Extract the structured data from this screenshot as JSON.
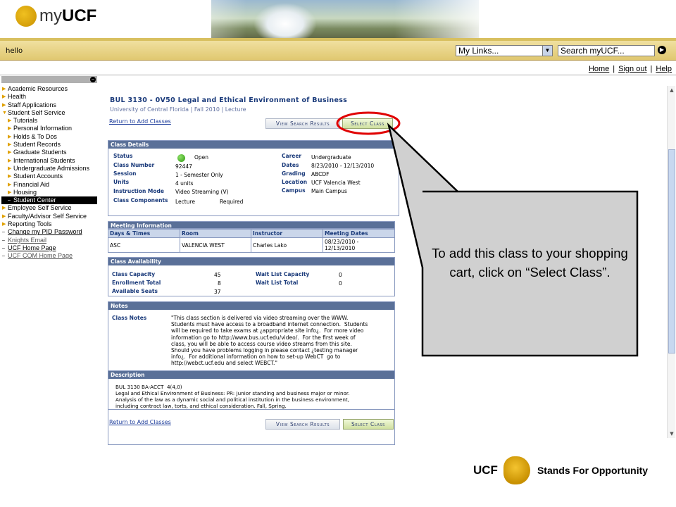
{
  "header": {
    "logo_my": "my",
    "logo_ucf": "UCF",
    "greeting": "hello",
    "mylinks_value": "My Links...",
    "search_placeholder": "Search myUCF...",
    "links": [
      "Home",
      "Sign out",
      "Help"
    ]
  },
  "menu": {
    "items": [
      {
        "label": "Academic Resources",
        "level": 0,
        "type": "folder"
      },
      {
        "label": "Health",
        "level": 0,
        "type": "folder"
      },
      {
        "label": "Staff Applications",
        "level": 0,
        "type": "folder"
      },
      {
        "label": "Student Self Service",
        "level": 0,
        "type": "open"
      },
      {
        "label": "Tutorials",
        "level": 1,
        "type": "folder"
      },
      {
        "label": "Personal Information",
        "level": 1,
        "type": "folder"
      },
      {
        "label": "Holds & To Dos",
        "level": 1,
        "type": "folder"
      },
      {
        "label": "Student Records",
        "level": 1,
        "type": "folder"
      },
      {
        "label": "Graduate Students",
        "level": 1,
        "type": "folder"
      },
      {
        "label": "International Students",
        "level": 1,
        "type": "folder"
      },
      {
        "label": "Undergraduate Admissions",
        "level": 1,
        "type": "folder"
      },
      {
        "label": "Student Accounts",
        "level": 1,
        "type": "folder"
      },
      {
        "label": "Financial Aid",
        "level": 1,
        "type": "folder"
      },
      {
        "label": "Housing",
        "level": 1,
        "type": "folder"
      },
      {
        "label": "Student Center",
        "level": 1,
        "type": "selected"
      },
      {
        "label": "Employee Self Service",
        "level": 0,
        "type": "folder"
      },
      {
        "label": "Faculty/Advisor Self Service",
        "level": 0,
        "type": "folder"
      },
      {
        "label": "Reporting Tools",
        "level": 0,
        "type": "folder"
      },
      {
        "label": "Change my PID Password",
        "level": 0,
        "type": "link"
      },
      {
        "label": "Knights Email",
        "level": 0,
        "type": "link-grey"
      },
      {
        "label": "UCF Home Page",
        "level": 0,
        "type": "link"
      },
      {
        "label": "UCF COM Home Page",
        "level": 0,
        "type": "link-grey"
      }
    ]
  },
  "course": {
    "title": "BUL 3130 - 0V50   Legal and Ethical Environment of Business",
    "subtitle": "University of Central Florida | Fall 2010 | Lecture",
    "return_link": "Return to Add Classes",
    "view_search_results": "View Search Results",
    "select_class": "Select Class"
  },
  "class_details": {
    "header": "Class Details",
    "status_label": "Status",
    "status_value": "Open",
    "class_number_label": "Class Number",
    "class_number_value": "92447",
    "session_label": "Session",
    "session_value": "1 - Semester Only",
    "units_label": "Units",
    "units_value": "4 units",
    "instruction_mode_label": "Instruction Mode",
    "instruction_mode_value": "Video Streaming (V)",
    "components_label": "Class Components",
    "components_value": "Lecture",
    "components_required": "Required",
    "career_label": "Career",
    "career_value": "Undergraduate",
    "dates_label": "Dates",
    "dates_value": "8/23/2010 - 12/13/2010",
    "grading_label": "Grading",
    "grading_value": "ABCDF",
    "location_label": "Location",
    "location_value": "UCF Valencia West",
    "campus_label": "Campus",
    "campus_value": "Main Campus"
  },
  "meeting_info": {
    "header": "Meeting Information",
    "columns": [
      "Days & Times",
      "Room",
      "Instructor",
      "Meeting Dates"
    ],
    "row": {
      "days": "ASC",
      "room": "VALENCIA WEST",
      "instructor": "Charles Lako",
      "dates_line1": "08/23/2010 -",
      "dates_line2": "12/13/2010"
    }
  },
  "availability": {
    "header": "Class Availability",
    "capacity_label": "Class Capacity",
    "capacity_value": "45",
    "enrollment_label": "Enrollment Total",
    "enrollment_value": "8",
    "seats_label": "Available Seats",
    "seats_value": "37",
    "wl_capacity_label": "Wait List Capacity",
    "wl_capacity_value": "0",
    "wl_total_label": "Wait List Total",
    "wl_total_value": "0"
  },
  "notes": {
    "header": "Notes",
    "label": "Class Notes",
    "text": "\"This class section is delivered via video streaming over the WWW.\nStudents must have access to a broadband internet connection.  Students\nwill be required to take exams at ¿appropriate site info¿.  For more video\ninformation go to http://www.bus.ucf.edu/video/.  For the first week of\nclass, you will be able to access course video streams from this site.\nShould you have problems logging in please contact ¿testing manager\ninfo¿.  For additional information on how to set-up WebCT  go to\nhttp://webct.ucf.edu and select WEBCT.\""
  },
  "description": {
    "header": "Description",
    "text": "BUL 3130 BA-ACCT  4(4,0)\nLegal and Ethical Environment of Business: PR: Junior standing and business major or minor.\nAnalysis of the law as a dynamic social and political institution in the business environment,\nincluding contract law, torts, and ethical consideration. Fall, Spring."
  },
  "callout": {
    "text": "To add this class to your shopping cart, click on “Select Class”."
  },
  "footer": {
    "ucf": "UCF",
    "slogan": "Stands For Opportunity"
  },
  "colors": {
    "accent_gold": "#e0c870",
    "panel_header": "#5a7098",
    "callout_highlight": "#e00000"
  }
}
